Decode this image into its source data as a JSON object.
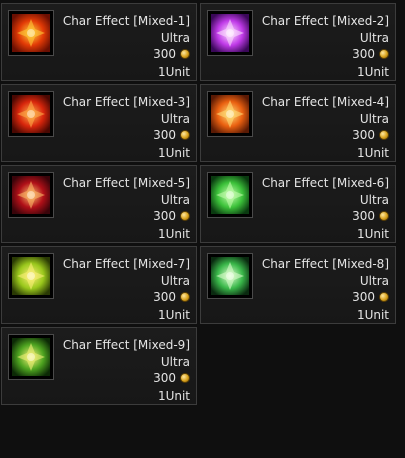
{
  "items": [
    {
      "name": "Char Effect [Mixed-1]",
      "grade": "Ultra",
      "price": "300",
      "unit": "1Unit",
      "icon": "fire-burst-icon",
      "c1": "#ffd23a",
      "c2": "#e23a06",
      "c3": "#6a0f02"
    },
    {
      "name": "Char Effect [Mixed-2]",
      "grade": "Ultra",
      "price": "300",
      "unit": "1Unit",
      "icon": "purple-star-icon",
      "c1": "#ffe3ff",
      "c2": "#c03ae8",
      "c3": "#3a0858"
    },
    {
      "name": "Char Effect [Mixed-3]",
      "grade": "Ultra",
      "price": "300",
      "unit": "1Unit",
      "icon": "red-swirl-icon",
      "c1": "#ffb24a",
      "c2": "#d8260c",
      "c3": "#4a0802"
    },
    {
      "name": "Char Effect [Mixed-4]",
      "grade": "Ultra",
      "price": "300",
      "unit": "1Unit",
      "icon": "phoenix-flame-icon",
      "c1": "#ffe27a",
      "c2": "#ea6010",
      "c3": "#5a1a04"
    },
    {
      "name": "Char Effect [Mixed-5]",
      "grade": "Ultra",
      "price": "300",
      "unit": "1Unit",
      "icon": "crimson-trident-icon",
      "c1": "#ffc06a",
      "c2": "#b01018",
      "c3": "#3a040a"
    },
    {
      "name": "Char Effect [Mixed-6]",
      "grade": "Ultra",
      "price": "300",
      "unit": "1Unit",
      "icon": "green-cloud-icon",
      "c1": "#c8ffb0",
      "c2": "#3cc23a",
      "c3": "#0a3a10"
    },
    {
      "name": "Char Effect [Mixed-7]",
      "grade": "Ultra",
      "price": "300",
      "unit": "1Unit",
      "icon": "yellow-green-trident-icon",
      "c1": "#fff07a",
      "c2": "#9ac81c",
      "c3": "#2a3a04"
    },
    {
      "name": "Char Effect [Mixed-8]",
      "grade": "Ultra",
      "price": "300",
      "unit": "1Unit",
      "icon": "green-phoenix-icon",
      "c1": "#e0ffd0",
      "c2": "#3ab84a",
      "c3": "#0a2a10"
    },
    {
      "name": "Char Effect [Mixed-9]",
      "grade": "Ultra",
      "price": "300",
      "unit": "1Unit",
      "icon": "green-gold-trident-icon",
      "c1": "#f8f27a",
      "c2": "#4ea420",
      "c3": "#0c2a06"
    }
  ]
}
